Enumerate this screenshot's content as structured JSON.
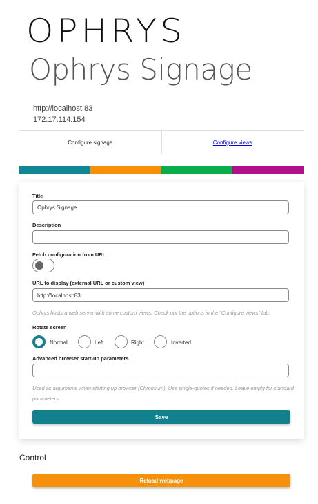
{
  "header": {
    "logo_text": "OPHRYS",
    "title": "Ophrys Signage",
    "url": "http://localhost:83",
    "ip": "172.17.114.154"
  },
  "tabs": [
    {
      "label": "Configure signage",
      "active": true
    },
    {
      "label": "Configure views",
      "active": false
    }
  ],
  "colors": {
    "accent_bar": [
      "#0f8794",
      "#f78f07",
      "#07ae4b",
      "#b20f8c"
    ],
    "primary": "#13808f",
    "secondary": "#f7900a"
  },
  "form": {
    "title_label": "Title",
    "title_value": "Ophrys Signage",
    "description_label": "Description",
    "description_value": "",
    "fetch_label": "Fetch configuration from URL",
    "fetch_enabled": false,
    "url_label": "URL to display (external URL or custom view)",
    "url_value": "http://localhost:83",
    "url_help": "Ophrys hosts a web server with some custom views. Check out the options in the \"Configure views\" tab.",
    "rotate_label": "Rotate screen",
    "rotate_options": [
      "Normal",
      "Left",
      "Right",
      "Inverted"
    ],
    "rotate_selected": "Normal",
    "params_label": "Advanced browser start-up parameters",
    "params_value": "",
    "params_help": "Used as arguments when starting up browser (Chromium). Use single-quotes if needed. Leave empty for standard parameters",
    "save_label": "Save"
  },
  "control": {
    "title": "Control",
    "reload_label": "Reload webpage"
  }
}
